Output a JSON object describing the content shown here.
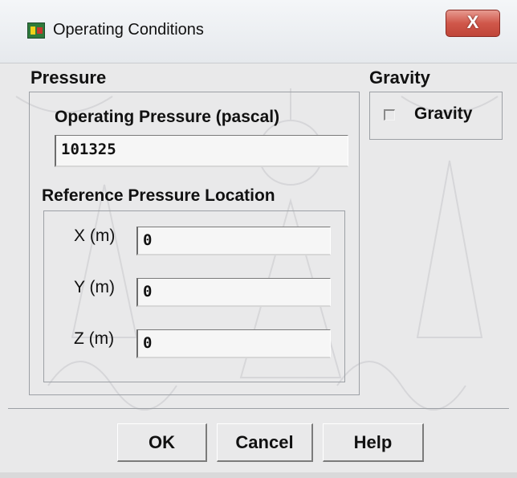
{
  "window": {
    "title": "Operating Conditions",
    "close_glyph": "X",
    "app_icon": "fluent-app-icon",
    "close_icon": "close-icon"
  },
  "pressure": {
    "group_title": "Pressure",
    "operating_label": "Operating Pressure (pascal)",
    "operating_value": "101325",
    "reference_title": "Reference Pressure Location",
    "coords": [
      {
        "label": "X (m)",
        "value": "0"
      },
      {
        "label": "Y (m)",
        "value": "0"
      },
      {
        "label": "Z (m)",
        "value": "0"
      }
    ]
  },
  "gravity": {
    "group_title": "Gravity",
    "checkbox_label": "Gravity",
    "checked": false
  },
  "buttons": {
    "ok": "OK",
    "cancel": "Cancel",
    "help": "Help"
  }
}
